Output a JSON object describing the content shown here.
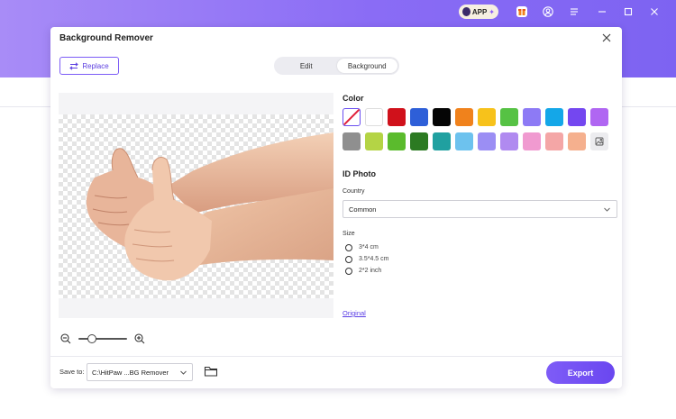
{
  "app": {
    "badge_label": "APP"
  },
  "dialog": {
    "title": "Background Remover",
    "replace_label": "Replace",
    "tabs": [
      {
        "label": "Edit",
        "active": false
      },
      {
        "label": "Background",
        "active": true
      }
    ]
  },
  "colors": {
    "heading": "Color",
    "row1": [
      "none",
      "#ffffff",
      "#d0111b",
      "#2e5fd8",
      "#050505",
      "#f0821c",
      "#f7c21b",
      "#56c244",
      "#8d7af5",
      "#14a7e8",
      "#7447f0",
      "#b066f2"
    ],
    "row2": [
      "#8f8f8f",
      "#b4d445",
      "#5bbb2d",
      "#2c7a22",
      "#20a0a0",
      "#6dc2ee",
      "#9b8ef4",
      "#b08af0",
      "#f09ad0",
      "#f4a6a6",
      "#f5b08e",
      "custom"
    ],
    "selected": "none"
  },
  "id_photo": {
    "heading": "ID Photo",
    "country_label": "Country",
    "country_value": "Common",
    "size_label": "Size",
    "sizes": [
      "3*4 cm",
      "3.5*4.5 cm",
      "2*2 inch"
    ]
  },
  "original_link": "Original",
  "footer": {
    "save_label": "Save to:",
    "path_value": "C:\\HitPaw ...BG Remover",
    "export_label": "Export"
  },
  "accent_color": "#7b5cf5"
}
